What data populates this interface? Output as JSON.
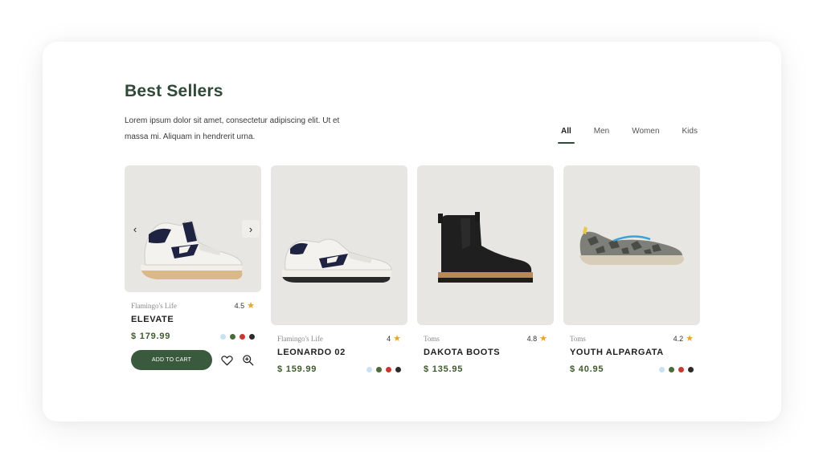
{
  "header": {
    "title": "Best Sellers",
    "description_line1": "Lorem ipsum dolor sit amet, consectetur adipiscing elit. Ut et",
    "description_line2": "massa mi. Aliquam in hendrerit urna."
  },
  "tabs": [
    {
      "label": "All",
      "active": true
    },
    {
      "label": "Men",
      "active": false
    },
    {
      "label": "Women",
      "active": false
    },
    {
      "label": "Kids",
      "active": false
    }
  ],
  "products": [
    {
      "brand": "Flamingo's Life",
      "rating": "4.5",
      "name": "ELEVATE",
      "price": "$ 179.99",
      "swatches": [
        "#c9e2f2",
        "#4d6a3a",
        "#c63a30",
        "#2c2c2c"
      ],
      "add_to_cart_label": "ADD TO CART",
      "show_carousel_arrows": true,
      "image": "high-top-sneaker"
    },
    {
      "brand": "Flamingo's Life",
      "rating": "4",
      "name": "LEONARDO 02",
      "price": "$ 159.99",
      "swatches": [
        "#c9e2f2",
        "#4d6a3a",
        "#c63a30",
        "#2c2c2c"
      ],
      "image": "low-top-sneaker"
    },
    {
      "brand": "Toms",
      "rating": "4.8",
      "name": "DAKOTA BOOTS",
      "price": "$ 135.95",
      "swatches": [],
      "image": "chelsea-boot"
    },
    {
      "brand": "Toms",
      "rating": "4.2",
      "name": "YOUTH ALPARGATA",
      "price": "$ 40.95",
      "swatches": [
        "#c9e2f2",
        "#4d6a3a",
        "#c63a30",
        "#2c2c2c"
      ],
      "image": "slip-on-shoe"
    }
  ],
  "icons": {
    "prev": "chevron-left-icon",
    "next": "chevron-right-icon",
    "wishlist": "heart-icon",
    "zoom": "zoom-in-icon",
    "rating": "star-icon"
  },
  "colors": {
    "accent": "#3a5a3e",
    "title": "#2f4a36",
    "price": "#3e5a2c",
    "star": "#e7a52a",
    "image_bg": "#e7e6e2"
  }
}
